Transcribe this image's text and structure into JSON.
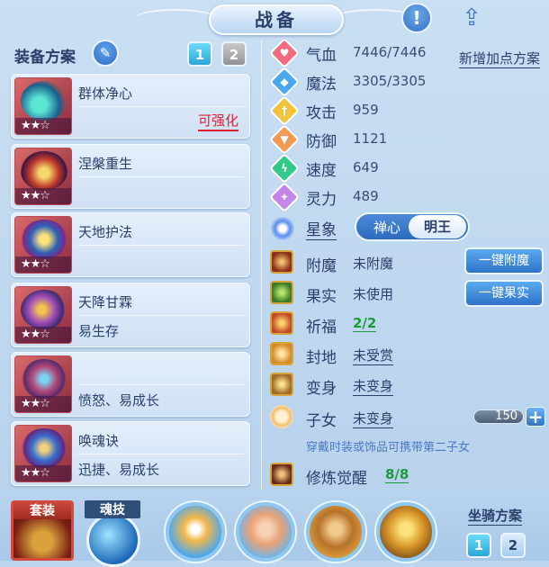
{
  "header": {
    "title": "战备",
    "info_icon": "!",
    "share_icon": "share-icon"
  },
  "left": {
    "plan_label": "装备方案",
    "plan_tabs": [
      "1",
      "2"
    ],
    "items": [
      {
        "name": "群体净心",
        "sub": "",
        "tag": "可强化",
        "stars": "★★☆"
      },
      {
        "name": "涅槃重生",
        "sub": "",
        "tag": "",
        "stars": "★★☆"
      },
      {
        "name": "天地护法",
        "sub": "",
        "tag": "",
        "stars": "★★☆"
      },
      {
        "name": "天降甘霖",
        "sub": "易生存",
        "tag": "",
        "stars": "★★☆"
      },
      {
        "name": "",
        "sub": "愤怒、易成长",
        "tag": "",
        "stars": "★★☆"
      },
      {
        "name": "唤魂诀",
        "sub": "迅捷、易成长",
        "tag": "",
        "stars": "★★☆"
      }
    ]
  },
  "stats": [
    {
      "label": "气血",
      "value": "7446/7446",
      "color": "#f26b7e"
    },
    {
      "label": "魔法",
      "value": "3305/3305",
      "color": "#4aa8f0"
    },
    {
      "label": "攻击",
      "value": "959",
      "color": "#f1c23b"
    },
    {
      "label": "防御",
      "value": "1121",
      "color": "#f39a52"
    },
    {
      "label": "速度",
      "value": "649",
      "color": "#2fc98a"
    },
    {
      "label": "灵力",
      "value": "489",
      "color": "#c484ea"
    }
  ],
  "add_point": "新增加点方案",
  "sign": {
    "label": "星象",
    "options": [
      "禅心",
      "明王"
    ]
  },
  "rows": [
    {
      "label": "附魔",
      "value": "未附魔",
      "style": ""
    },
    {
      "label": "果实",
      "value": "未使用",
      "style": ""
    },
    {
      "label": "祈福",
      "value": "2/2",
      "style": "g"
    },
    {
      "label": "封地",
      "value": "未受赏",
      "style": "u"
    },
    {
      "label": "变身",
      "value": "未变身",
      "style": "u"
    },
    {
      "label": "子女",
      "value": "未变身",
      "style": "u"
    },
    {
      "label": "修炼觉醒",
      "value": "8/8",
      "style": "g"
    }
  ],
  "buttons": {
    "enchant": "一键附魔",
    "fruit": "一键果实"
  },
  "child_level": "150",
  "hint": "穿戴时装或饰品可携带第二子女",
  "bottom": {
    "suit_label": "套装",
    "soul_label": "魂技",
    "mount_label": "坐骑方案",
    "mount_tabs": [
      "1",
      "2"
    ]
  }
}
